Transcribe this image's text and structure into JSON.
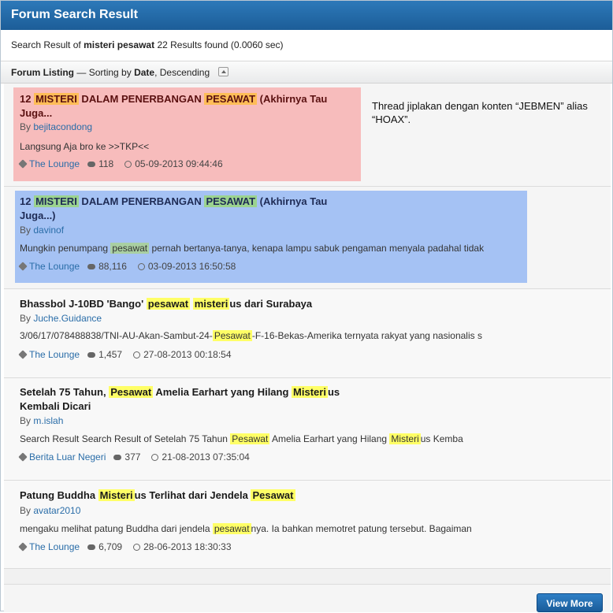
{
  "header": {
    "title": "Forum Search Result"
  },
  "info": {
    "prefix": "Search Result of",
    "query": "misteri pesawat",
    "suffix": "22 Results found (0.0060 sec)"
  },
  "listing": {
    "label": "Forum Listing",
    "dash": "—",
    "sorting_text": "Sorting by",
    "sort_field": "Date",
    "sort_order": "Descending"
  },
  "results": [
    {
      "title": [
        "12 ",
        "MISTERI",
        " DALAM PENERBANGAN ",
        "PESAWAT",
        " (Akhirnya Tau",
        "Juga..."
      ],
      "by": "By",
      "author": "bejitacondong",
      "snippet": "Langsung Aja bro ke >>TKP<<",
      "category": "The Lounge",
      "replies": "118",
      "date": "05-09-2013 09:44:46",
      "note": "Thread jiplakan dengan konten “JEBMEN” alias “HOAX”."
    },
    {
      "title": [
        "12 ",
        "MISTERI",
        " DALAM PENERBANGAN ",
        "PESAWAT",
        " (Akhirnya Tau",
        "Juga...)"
      ],
      "by": "By",
      "author": "davinof",
      "snippet_pre": "Mungkin penumpang ",
      "snippet_hl": "pesawat",
      "snippet_post": " pernah bertanya-tanya, kenapa lampu sabuk pengaman menyala padahal tidak",
      "category": "The Lounge",
      "replies": "88,116",
      "date": "03-09-2013 16:50:58"
    },
    {
      "title": [
        "Bhassbol J-10BD 'Bango' ",
        "pesawat",
        " ",
        "misteri",
        "us dari Surabaya"
      ],
      "by": "By",
      "author": "Juche.Guidance",
      "snippet_pre": "3/06/17/078488838/TNI-AU-Akan-Sambut-24-",
      "snippet_hl": "Pesawat",
      "snippet_post": "-F-16-Bekas-Amerika ternyata rakyat yang nasionalis s",
      "category": "The Lounge",
      "replies": "1,457",
      "date": "27-08-2013 00:18:54"
    },
    {
      "title": [
        "Setelah 75 Tahun, ",
        "Pesawat",
        " Amelia Earhart yang Hilang ",
        "Misteri",
        "us Kembali Dicari"
      ],
      "by": "By",
      "author": "m.islah",
      "snippet_pre": "Search Result Search Result of Setelah 75 Tahun ",
      "snippet_hl": "Pesawat",
      "snippet_mid": " Amelia Earhart yang Hilang ",
      "snippet_hl2": "Misteri",
      "snippet_post": "us Kemba",
      "category": "Berita Luar Negeri",
      "replies": "377",
      "date": "21-08-2013 07:35:04"
    },
    {
      "title": [
        "Patung Buddha ",
        "Misteri",
        "us Terlihat dari Jendela ",
        "Pesawat"
      ],
      "by": "By",
      "author": "avatar2010",
      "snippet_pre": "mengaku melihat patung Buddha dari jendela ",
      "snippet_hl": "pesawat",
      "snippet_post": "nya. Ia bahkan memotret patung tersebut. Bagaiman",
      "category": "The Lounge",
      "replies": "6,709",
      "date": "28-06-2013 18:30:33"
    }
  ],
  "footer": {
    "view_more": "View More"
  },
  "icons": {
    "tag": "tag-icon",
    "replies": "comment-icon",
    "date": "clock-icon",
    "sort": "sort-toggle-icon"
  },
  "colors": {
    "header": "#2d79b9",
    "highlight_red": "#f7bcbc",
    "highlight_blue": "#a5c2f4",
    "keyword": "#ffff66"
  }
}
